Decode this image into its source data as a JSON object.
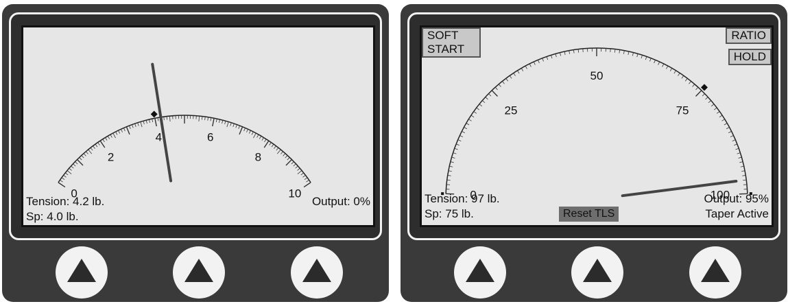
{
  "left_panel": {
    "gauge": {
      "min": 0,
      "max": 10,
      "labels": [
        "0",
        "2",
        "4",
        "6",
        "8",
        "10"
      ],
      "setpoint_marker": 4.0,
      "needle_value": 4.2
    },
    "tension": "Tension: 4.2 lb.",
    "setpoint": "Sp: 4.0 lb.",
    "output": "Output: 0%",
    "buttons": [
      {
        "icon": "triangle-up-icon"
      },
      {
        "icon": "triangle-up-icon"
      },
      {
        "icon": "triangle-up-icon"
      }
    ]
  },
  "right_panel": {
    "gauge": {
      "min": 0,
      "max": 100,
      "labels": [
        "0",
        "25",
        "50",
        "75",
        "100"
      ],
      "setpoint_marker": 75,
      "limit_markers": [
        0,
        100
      ],
      "needle_value": 97
    },
    "soft_start": "SOFT START",
    "ratio": "RATIO",
    "hold": "HOLD",
    "tension": "Tension: 97 lb.",
    "setpoint": "Sp: 75 lb.",
    "reset": "Reset TLS",
    "output": "Output: 95%",
    "taper": "Taper Active",
    "buttons": [
      {
        "icon": "triangle-up-icon"
      },
      {
        "icon": "triangle-up-icon"
      },
      {
        "icon": "triangle-up-icon"
      }
    ]
  },
  "colors": {
    "screen": "#e6e6e6",
    "housing": "#3a3a3a",
    "needle": "#444444",
    "button": "#f2f2f2"
  }
}
